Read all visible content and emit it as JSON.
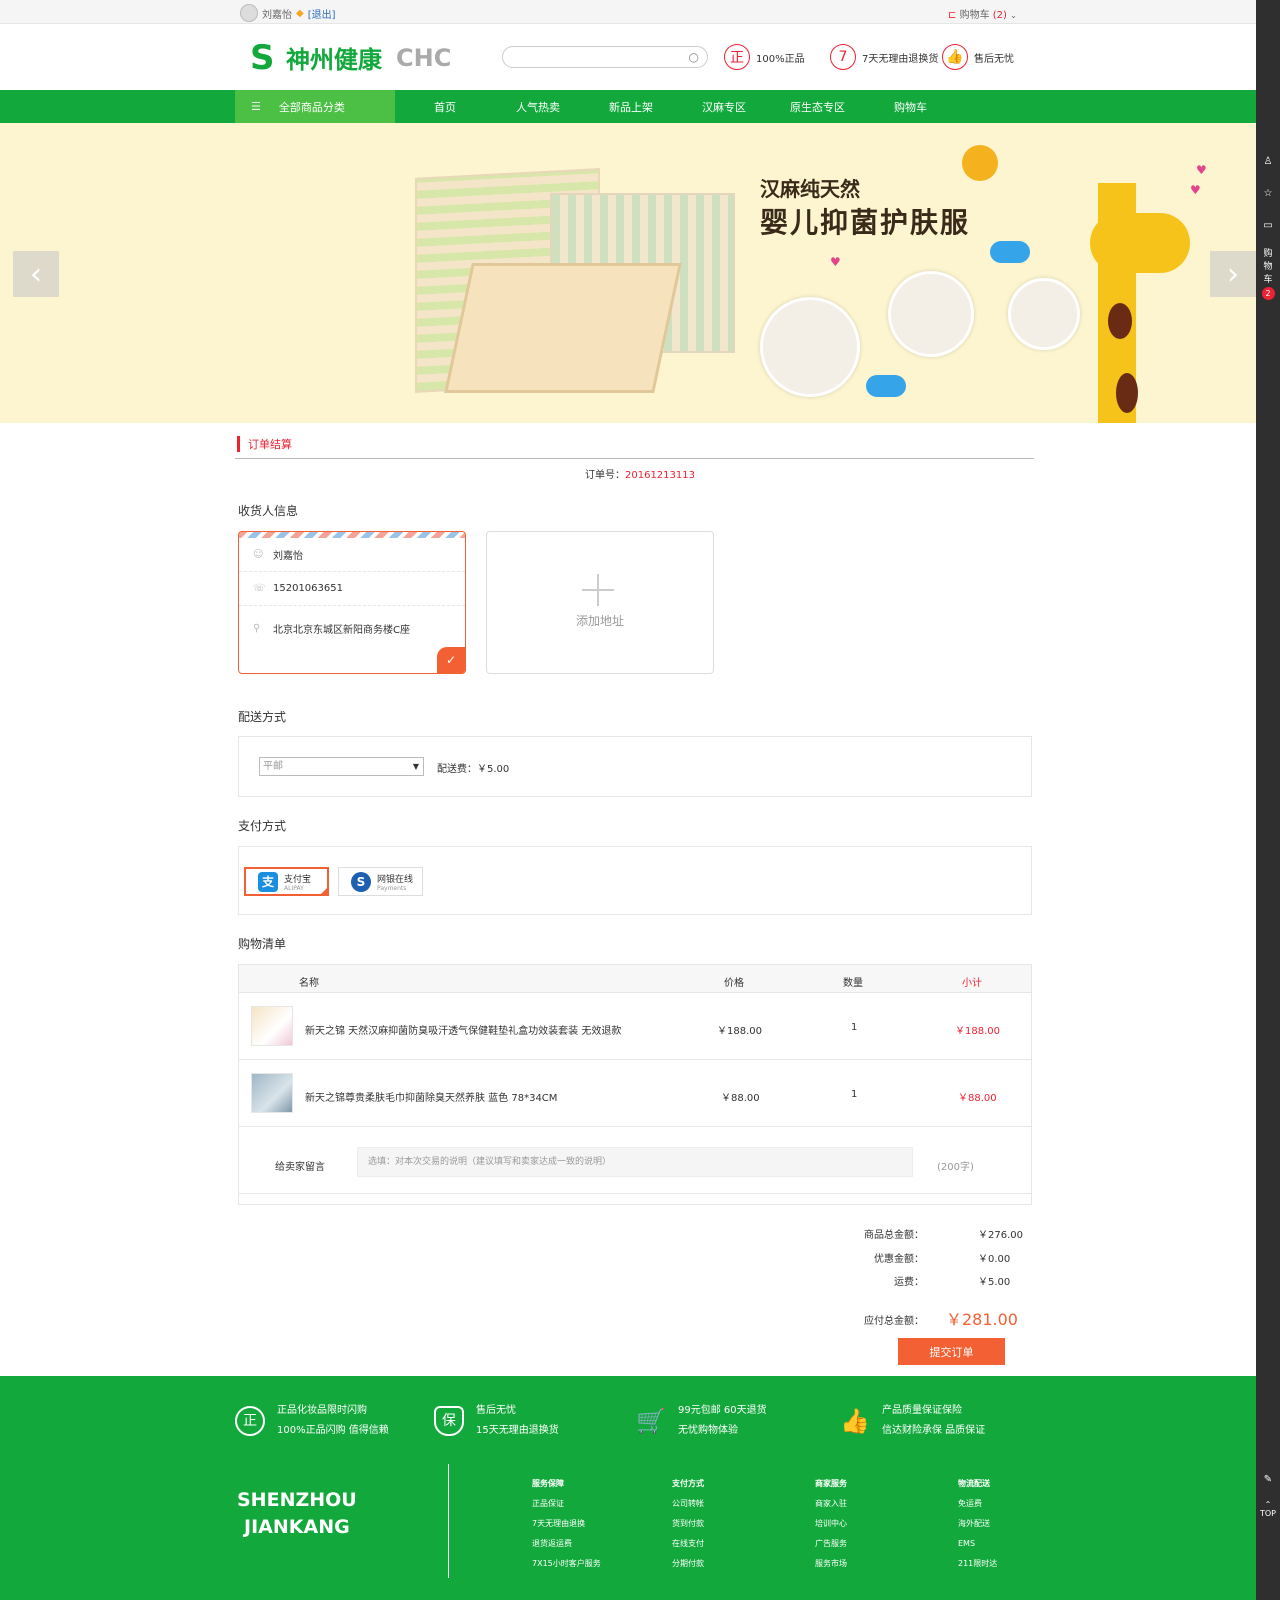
{
  "topbar": {
    "username": "刘嘉怡",
    "logout": "[退出]",
    "cart_label": "购物车",
    "cart_count": "(2)"
  },
  "header": {
    "logo_cn": "神州健康",
    "logo_en": "CHC",
    "search_placeholder": "",
    "promises": [
      {
        "icon": "正",
        "label": "100%正品"
      },
      {
        "icon": "7",
        "label": "7天无理由退换货"
      },
      {
        "icon": "thumb-up-icon",
        "label": "售后无忧"
      }
    ]
  },
  "nav": {
    "all_categories": "全部商品分类",
    "items": [
      "首页",
      "人气热卖",
      "新品上架",
      "汉麻专区",
      "原生态专区",
      "购物车"
    ]
  },
  "banner": {
    "line1": "汉麻纯天然",
    "line2": "婴儿抑菌护肤服"
  },
  "order": {
    "section_title": "订单结算",
    "order_no_label": "订单号：",
    "order_no": "20161213113",
    "receiver_title": "收货人信息",
    "address": {
      "name": "刘嘉怡",
      "phone": "15201063651",
      "address": "北京北京东城区新阳商务楼C座"
    },
    "add_address": "添加地址",
    "shipping_title": "配送方式",
    "shipping_method": "平邮",
    "shipping_fee": "配送费：￥5.00",
    "payment_title": "支付方式",
    "payments": [
      {
        "name": "支付宝",
        "sub": "ALIPAY",
        "selected": true
      },
      {
        "name": "网银在线",
        "sub": "Payments",
        "selected": false
      }
    ],
    "cart_title": "购物清单",
    "columns": [
      "名称",
      "价格",
      "数量",
      "小计"
    ],
    "items": [
      {
        "name": "新天之锦 天然汉麻抑菌防臭吸汗透气保健鞋垫礼盒功效装套装 无效退款",
        "price": "￥188.00",
        "qty": "1",
        "subtotal": "￥188.00"
      },
      {
        "name": "新天之锦尊贵柔肤毛巾抑菌除臭天然养肤 蓝色 78*34CM",
        "price": "￥88.00",
        "qty": "1",
        "subtotal": "￥88.00"
      }
    ],
    "message_label": "给卖家留言",
    "message_placeholder": "选填：对本次交易的说明（建议填写和卖家达成一致的说明）",
    "message_limit": "(200字)",
    "summary": [
      {
        "label": "商品总金额：",
        "value": "￥276.00"
      },
      {
        "label": "优惠金额：",
        "value": "￥0.00"
      },
      {
        "label": "运费：",
        "value": "￥5.00"
      }
    ],
    "total_label": "应付总金额：",
    "total_value": "￥281.00",
    "submit": "提交订单"
  },
  "footer": {
    "promises": [
      {
        "icon": "正",
        "line1": "正品化妆品限时闪购",
        "line2": "100%正品闪购 值得信赖"
      },
      {
        "icon": "保",
        "line1": "售后无忧",
        "line2": "15天无理由退换货"
      },
      {
        "icon": "cart-icon",
        "line1": "99元包邮 60天退货",
        "line2": "无忧购物体验"
      },
      {
        "icon": "thumb-up-icon",
        "line1": "产品质量保证保险",
        "line2": "信达财险承保 品质保证"
      }
    ],
    "brand_line1": "SHENZHOU",
    "brand_line2": "JIANKANG",
    "columns": [
      {
        "title": "服务保障",
        "links": [
          "正品保证",
          "7天无理由退换",
          "退货返运费",
          "7X15小时客户服务"
        ]
      },
      {
        "title": "支付方式",
        "links": [
          "公司转帐",
          "货到付款",
          "在线支付",
          "分期付款"
        ]
      },
      {
        "title": "商家服务",
        "links": [
          "商家入驻",
          "培训中心",
          "广告服务",
          "服务市场"
        ]
      },
      {
        "title": "物流配送",
        "links": [
          "免运费",
          "海外配送",
          "EMS",
          "211限时达"
        ]
      }
    ]
  },
  "sidebar": {
    "cart": "购物车",
    "cart_count": "2",
    "top": "TOP"
  },
  "colors": {
    "green": "#12a83c",
    "accent": "#f26033",
    "price": "#e23"
  }
}
